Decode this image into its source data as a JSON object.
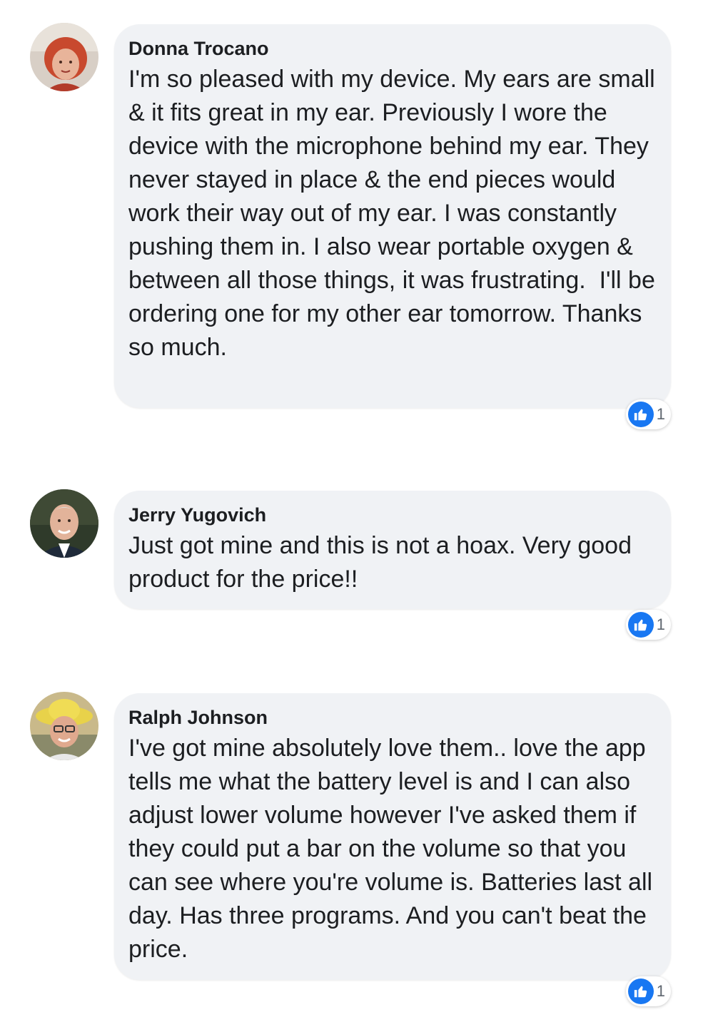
{
  "comments": [
    {
      "author": "Donna Trocano",
      "text": "I'm so pleased with my device. My ears are small & it fits great in my ear. Previously I wore the device with the microphone behind my ear. They never stayed in place & the end pieces would work their way out of my ear. I was constantly pushing them in. I also wear portable oxygen & between all those things, it was frustrating.  I'll be ordering one for my other ear tomorrow. Thanks so much.",
      "reaction_icon": "like-icon",
      "reaction_count": "1"
    },
    {
      "author": "Jerry Yugovich",
      "text": "Just got mine and this is not a hoax. Very good product for the price!!",
      "reaction_icon": "like-icon",
      "reaction_count": "1"
    },
    {
      "author": "Ralph Johnson",
      "text": "I've got mine absolutely love them.. love the app tells me what the battery level is and I can also adjust lower volume however I've asked them if they could put a bar on the volume so that you can see where you're volume is. Batteries last all day. Has three programs. And you can't beat the price.",
      "reaction_icon": "like-icon",
      "reaction_count": "1"
    }
  ],
  "colors": {
    "bubble_background": "#f0f2f5",
    "like_blue": "#1877f2",
    "text": "#1c1e21"
  }
}
